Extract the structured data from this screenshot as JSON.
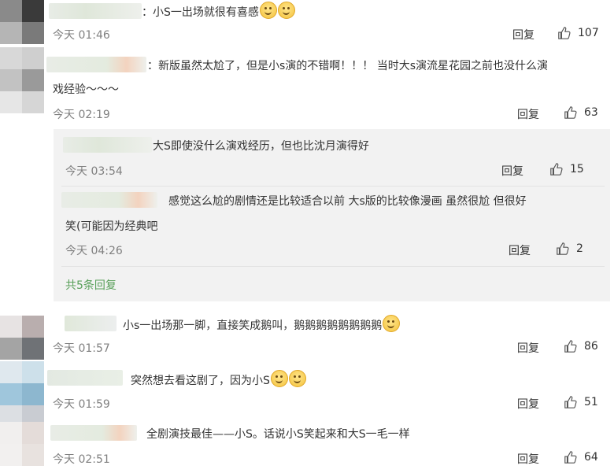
{
  "comments": [
    {
      "text": "：小S一出场就很有喜感",
      "time": "今天 01:46",
      "reply": "回复",
      "likes": "107"
    },
    {
      "text_line1": "：新版虽然太尬了，但是小s演的不错啊！！！ 当时大s演流星花园之前也没什么演",
      "text_line2": "戏经验～～～",
      "time": "今天 02:19",
      "reply": "回复",
      "likes": "63"
    },
    {
      "text": "小s一出场那一脚，直接笑成鹅叫，鹅鹅鹅鹅鹅鹅鹅鹅",
      "time": "今天 01:57",
      "reply": "回复",
      "likes": "86"
    },
    {
      "text": "突然想去看这剧了，因为小S",
      "time": "今天 01:59",
      "reply": "回复",
      "likes": "51"
    },
    {
      "text": "全剧演技最佳——小S。话说小S笑起来和大S一毛一样",
      "time": "今天 02:51",
      "reply": "回复",
      "likes": "64"
    }
  ],
  "sub_replies": [
    {
      "text": "大S即使没什么演戏经历，但也比沈月演得好",
      "time": "今天 03:54",
      "reply": "回复",
      "likes": "15"
    },
    {
      "text_line1": "感觉这么尬的剧情还是比较适合以前 大s版的比较像漫画 虽然很尬  但很好",
      "text_line2": "笑(可能因为经典吧",
      "time": "今天 04:26",
      "reply": "回复",
      "likes": "2"
    }
  ],
  "more_replies": "共5条回复",
  "icons": {
    "like": "thumbs-up-icon",
    "emoji": "grin-emoji-icon"
  }
}
